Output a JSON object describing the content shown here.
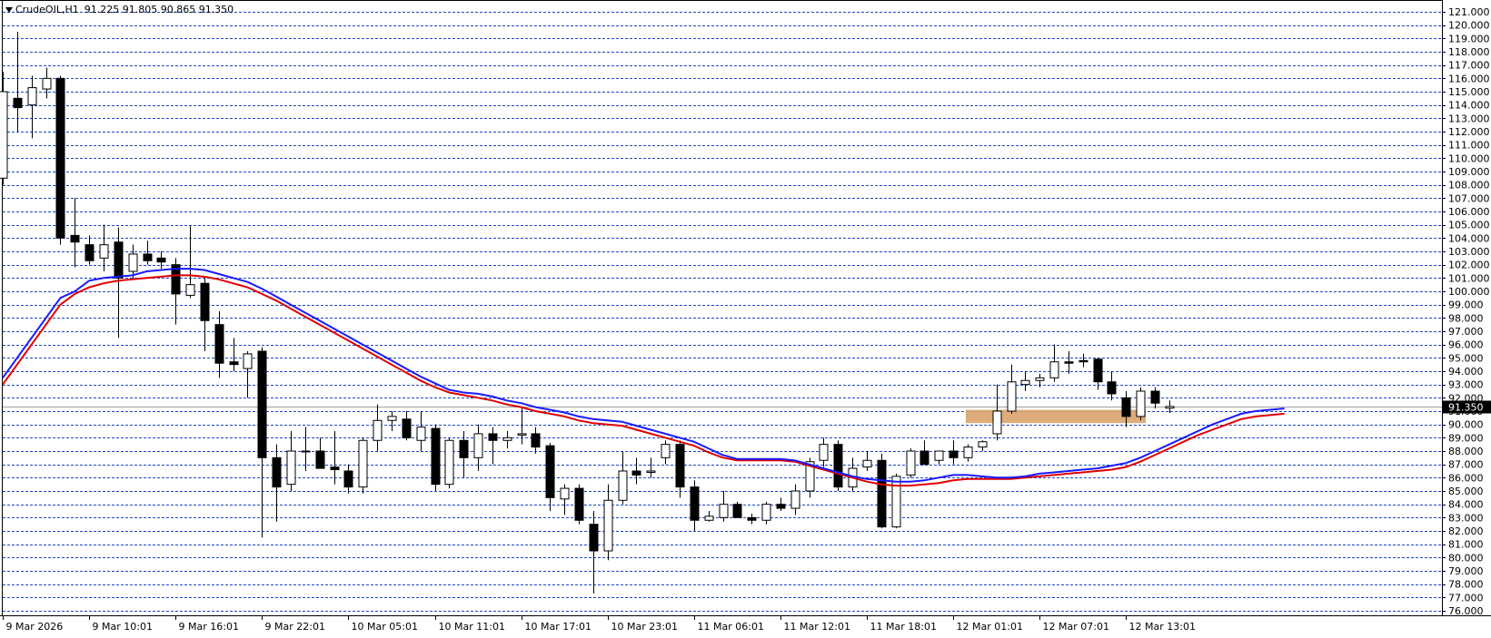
{
  "symbol_line": {
    "symbol": "CrudeOIL,H1",
    "values": "91.225 91.805 90.865 91.350"
  },
  "colors": {
    "background": "#ffffff",
    "grid": "#1b46c8",
    "bull_body": "#ffffff",
    "bear_body": "#000000",
    "ma_fast": "#1a1aff",
    "ma_slow": "#e00000",
    "zone": "#d9a36b"
  },
  "chart_data": {
    "type": "candlestick",
    "ylim": [
      76,
      121
    ],
    "y_ticks": [
      "76.000",
      "77.000",
      "78.000",
      "79.000",
      "80.000",
      "81.000",
      "82.000",
      "83.000",
      "84.000",
      "85.000",
      "86.000",
      "87.000",
      "88.000",
      "89.000",
      "90.000",
      "91.000",
      "92.000",
      "93.000",
      "94.000",
      "95.000",
      "96.000",
      "97.000",
      "98.000",
      "99.000",
      "100.000",
      "101.000",
      "102.000",
      "103.000",
      "104.000",
      "105.000",
      "106.000",
      "107.000",
      "108.000",
      "109.000",
      "110.000",
      "111.000",
      "112.000",
      "113.000",
      "114.000",
      "115.000",
      "116.000",
      "117.000",
      "118.000",
      "119.000",
      "120.000",
      "121.000"
    ],
    "x_labels": [
      {
        "label": "9 Mar 2026",
        "index": 0
      },
      {
        "label": "9 Mar 10:01",
        "index": 6
      },
      {
        "label": "9 Mar 16:01",
        "index": 12
      },
      {
        "label": "9 Mar 22:01",
        "index": 18
      },
      {
        "label": "10 Mar 05:01",
        "index": 24
      },
      {
        "label": "10 Mar 11:01",
        "index": 30
      },
      {
        "label": "10 Mar 17:01",
        "index": 36
      },
      {
        "label": "10 Mar 23:01",
        "index": 42
      },
      {
        "label": "11 Mar 06:01",
        "index": 48
      },
      {
        "label": "11 Mar 12:01",
        "index": 54
      },
      {
        "label": "11 Mar 18:01",
        "index": 60
      },
      {
        "label": "12 Mar 01:01",
        "index": 66
      },
      {
        "label": "12 Mar 07:01",
        "index": 72
      },
      {
        "label": "12 Mar 13:01",
        "index": 78
      }
    ],
    "candles": [
      {
        "o": 108.5,
        "h": 116.5,
        "l": 108.0,
        "c": 115.0
      },
      {
        "o": 114.5,
        "h": 119.5,
        "l": 112.0,
        "c": 113.8
      },
      {
        "o": 114.0,
        "h": 116.2,
        "l": 111.5,
        "c": 115.3
      },
      {
        "o": 115.2,
        "h": 116.8,
        "l": 114.5,
        "c": 116.0
      },
      {
        "o": 116.0,
        "h": 116.2,
        "l": 103.5,
        "c": 104.0
      },
      {
        "o": 104.2,
        "h": 107.0,
        "l": 101.8,
        "c": 103.7
      },
      {
        "o": 103.5,
        "h": 104.2,
        "l": 102.0,
        "c": 102.3
      },
      {
        "o": 102.5,
        "h": 105.0,
        "l": 101.5,
        "c": 103.5
      },
      {
        "o": 103.7,
        "h": 104.8,
        "l": 96.5,
        "c": 101.0
      },
      {
        "o": 101.5,
        "h": 103.5,
        "l": 101.0,
        "c": 102.8
      },
      {
        "o": 102.8,
        "h": 103.8,
        "l": 102.0,
        "c": 102.3
      },
      {
        "o": 102.5,
        "h": 103.0,
        "l": 101.7,
        "c": 102.2
      },
      {
        "o": 102.0,
        "h": 102.5,
        "l": 97.5,
        "c": 99.8
      },
      {
        "o": 99.7,
        "h": 104.9,
        "l": 99.5,
        "c": 100.5
      },
      {
        "o": 100.6,
        "h": 101.0,
        "l": 95.5,
        "c": 97.8
      },
      {
        "o": 97.5,
        "h": 98.5,
        "l": 93.5,
        "c": 94.6
      },
      {
        "o": 94.7,
        "h": 96.5,
        "l": 94.0,
        "c": 94.5
      },
      {
        "o": 94.2,
        "h": 95.5,
        "l": 92.0,
        "c": 95.3
      },
      {
        "o": 95.5,
        "h": 95.8,
        "l": 81.5,
        "c": 87.5
      },
      {
        "o": 87.5,
        "h": 88.5,
        "l": 82.7,
        "c": 85.3
      },
      {
        "o": 85.5,
        "h": 89.5,
        "l": 85.0,
        "c": 88.0
      },
      {
        "o": 88.0,
        "h": 89.8,
        "l": 86.5,
        "c": 88.0
      },
      {
        "o": 88.0,
        "h": 89.0,
        "l": 87.0,
        "c": 86.7
      },
      {
        "o": 86.8,
        "h": 89.5,
        "l": 85.5,
        "c": 86.6
      },
      {
        "o": 86.5,
        "h": 87.0,
        "l": 84.8,
        "c": 85.3
      },
      {
        "o": 85.3,
        "h": 89.0,
        "l": 84.8,
        "c": 88.8
      },
      {
        "o": 88.8,
        "h": 91.5,
        "l": 88.0,
        "c": 90.3
      },
      {
        "o": 90.3,
        "h": 91.0,
        "l": 89.5,
        "c": 90.6
      },
      {
        "o": 90.4,
        "h": 91.0,
        "l": 88.8,
        "c": 89.0
      },
      {
        "o": 88.8,
        "h": 91.0,
        "l": 88.0,
        "c": 89.8
      },
      {
        "o": 89.7,
        "h": 90.0,
        "l": 85.0,
        "c": 85.5
      },
      {
        "o": 85.5,
        "h": 89.0,
        "l": 85.2,
        "c": 88.8
      },
      {
        "o": 88.8,
        "h": 89.5,
        "l": 86.0,
        "c": 87.5
      },
      {
        "o": 87.5,
        "h": 90.0,
        "l": 86.5,
        "c": 89.3
      },
      {
        "o": 89.3,
        "h": 89.8,
        "l": 87.0,
        "c": 88.8
      },
      {
        "o": 88.8,
        "h": 89.5,
        "l": 88.2,
        "c": 89.0
      },
      {
        "o": 89.2,
        "h": 91.2,
        "l": 88.5,
        "c": 89.3
      },
      {
        "o": 89.3,
        "h": 89.8,
        "l": 87.8,
        "c": 88.3
      },
      {
        "o": 88.4,
        "h": 88.6,
        "l": 83.5,
        "c": 84.5
      },
      {
        "o": 84.4,
        "h": 85.5,
        "l": 83.2,
        "c": 85.2
      },
      {
        "o": 85.2,
        "h": 85.5,
        "l": 82.5,
        "c": 82.8
      },
      {
        "o": 82.5,
        "h": 83.5,
        "l": 77.3,
        "c": 80.5
      },
      {
        "o": 80.5,
        "h": 85.5,
        "l": 79.8,
        "c": 84.3
      },
      {
        "o": 84.3,
        "h": 88.0,
        "l": 84.0,
        "c": 86.5
      },
      {
        "o": 86.5,
        "h": 87.5,
        "l": 85.5,
        "c": 86.2
      },
      {
        "o": 86.4,
        "h": 87.5,
        "l": 86.0,
        "c": 86.5
      },
      {
        "o": 87.5,
        "h": 88.8,
        "l": 87.0,
        "c": 88.5
      },
      {
        "o": 88.5,
        "h": 88.8,
        "l": 84.5,
        "c": 85.3
      },
      {
        "o": 85.3,
        "h": 85.8,
        "l": 82.0,
        "c": 82.8
      },
      {
        "o": 82.8,
        "h": 83.5,
        "l": 82.7,
        "c": 83.1
      },
      {
        "o": 83.0,
        "h": 85.0,
        "l": 82.7,
        "c": 84.0
      },
      {
        "o": 84.0,
        "h": 84.2,
        "l": 83.0,
        "c": 83.0
      },
      {
        "o": 83.0,
        "h": 83.3,
        "l": 82.5,
        "c": 82.8
      },
      {
        "o": 82.8,
        "h": 84.2,
        "l": 82.5,
        "c": 84.0
      },
      {
        "o": 84.0,
        "h": 84.5,
        "l": 83.5,
        "c": 83.7
      },
      {
        "o": 83.7,
        "h": 85.5,
        "l": 83.2,
        "c": 85.0
      },
      {
        "o": 85.0,
        "h": 87.5,
        "l": 84.5,
        "c": 87.2
      },
      {
        "o": 87.3,
        "h": 89.0,
        "l": 86.8,
        "c": 88.5
      },
      {
        "o": 88.5,
        "h": 88.8,
        "l": 85.0,
        "c": 85.3
      },
      {
        "o": 85.3,
        "h": 87.5,
        "l": 85.0,
        "c": 86.7
      },
      {
        "o": 86.8,
        "h": 88.0,
        "l": 86.5,
        "c": 87.3
      },
      {
        "o": 87.3,
        "h": 87.8,
        "l": 82.2,
        "c": 82.3
      },
      {
        "o": 82.3,
        "h": 86.3,
        "l": 82.2,
        "c": 86.1
      },
      {
        "o": 86.2,
        "h": 88.2,
        "l": 86.0,
        "c": 88.0
      },
      {
        "o": 88.0,
        "h": 88.8,
        "l": 87.0,
        "c": 87.0
      },
      {
        "o": 87.3,
        "h": 88.0,
        "l": 87.0,
        "c": 88.0
      },
      {
        "o": 88.0,
        "h": 88.8,
        "l": 87.0,
        "c": 87.5
      },
      {
        "o": 87.5,
        "h": 88.5,
        "l": 87.2,
        "c": 88.3
      },
      {
        "o": 88.3,
        "h": 88.8,
        "l": 88.0,
        "c": 88.7
      },
      {
        "o": 89.3,
        "h": 93.0,
        "l": 88.8,
        "c": 91.0
      },
      {
        "o": 91.0,
        "h": 94.5,
        "l": 90.8,
        "c": 93.2
      },
      {
        "o": 93.0,
        "h": 94.0,
        "l": 92.5,
        "c": 93.3
      },
      {
        "o": 93.3,
        "h": 93.8,
        "l": 92.8,
        "c": 93.5
      },
      {
        "o": 93.5,
        "h": 96.0,
        "l": 93.2,
        "c": 94.7
      },
      {
        "o": 94.7,
        "h": 95.5,
        "l": 93.8,
        "c": 94.6
      },
      {
        "o": 94.8,
        "h": 95.3,
        "l": 94.3,
        "c": 94.7
      },
      {
        "o": 94.9,
        "h": 95.0,
        "l": 92.6,
        "c": 93.2
      },
      {
        "o": 93.2,
        "h": 94.0,
        "l": 91.8,
        "c": 92.3
      },
      {
        "o": 92.0,
        "h": 92.5,
        "l": 89.8,
        "c": 90.6
      },
      {
        "o": 90.6,
        "h": 92.8,
        "l": 90.3,
        "c": 92.5
      },
      {
        "o": 92.5,
        "h": 92.8,
        "l": 91.2,
        "c": 91.6
      },
      {
        "o": 91.225,
        "h": 91.805,
        "l": 90.865,
        "c": 91.35
      }
    ],
    "ma_fast": [
      93.5,
      95.0,
      96.5,
      98.0,
      99.5,
      100.0,
      100.8,
      101.0,
      101.1,
      101.2,
      101.5,
      101.6,
      101.7,
      101.7,
      101.6,
      101.3,
      101.0,
      100.7,
      100.2,
      99.6,
      99.0,
      98.4,
      97.8,
      97.2,
      96.6,
      96.0,
      95.4,
      94.8,
      94.2,
      93.6,
      93.1,
      92.6,
      92.4,
      92.3,
      92.1,
      91.8,
      91.6,
      91.3,
      91.1,
      90.9,
      90.6,
      90.4,
      90.3,
      90.2,
      89.9,
      89.6,
      89.3,
      89.0,
      88.7,
      88.2,
      87.7,
      87.4,
      87.4,
      87.4,
      87.4,
      87.3,
      87.0,
      86.7,
      86.4,
      86.1,
      85.9,
      85.8,
      85.7,
      85.7,
      85.8,
      86.0,
      86.2,
      86.2,
      86.1,
      86.0,
      86.0,
      86.1,
      86.3,
      86.4,
      86.5,
      86.6,
      86.7,
      86.9,
      87.1,
      87.5,
      88.0,
      88.5,
      89.0,
      89.5,
      90.0,
      90.4,
      90.8,
      91.0,
      91.1,
      91.2
    ],
    "ma_slow": [
      93.0,
      94.5,
      96.0,
      97.5,
      99.0,
      99.8,
      100.3,
      100.6,
      100.8,
      100.9,
      101.0,
      101.1,
      101.2,
      101.2,
      101.1,
      100.9,
      100.6,
      100.3,
      99.8,
      99.3,
      98.7,
      98.1,
      97.5,
      96.9,
      96.3,
      95.7,
      95.1,
      94.5,
      93.9,
      93.3,
      92.8,
      92.4,
      92.2,
      92.0,
      91.8,
      91.5,
      91.3,
      91.0,
      90.8,
      90.6,
      90.3,
      90.1,
      90.0,
      89.9,
      89.6,
      89.3,
      89.0,
      88.7,
      88.4,
      87.9,
      87.5,
      87.3,
      87.3,
      87.3,
      87.3,
      87.2,
      86.9,
      86.6,
      86.3,
      86.0,
      85.7,
      85.5,
      85.4,
      85.4,
      85.5,
      85.6,
      85.8,
      85.9,
      85.9,
      85.9,
      85.9,
      86.0,
      86.1,
      86.2,
      86.3,
      86.4,
      86.5,
      86.6,
      86.8,
      87.2,
      87.7,
      88.2,
      88.7,
      89.2,
      89.6,
      90.0,
      90.4,
      90.6,
      90.7,
      90.8
    ],
    "zone": {
      "from_index": 67,
      "to_index": 79,
      "low": 90.1,
      "high": 91.1
    },
    "current_price": 91.35
  }
}
